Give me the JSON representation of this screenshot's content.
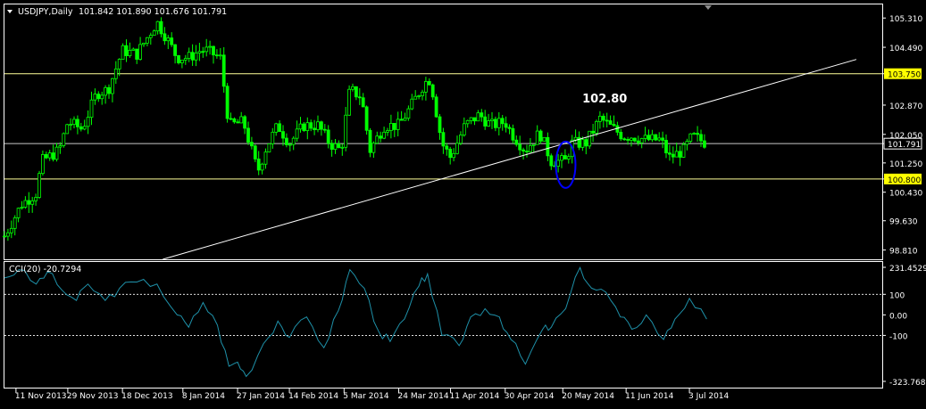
{
  "header": {
    "symbol": "USDJPY,Daily",
    "ohlc": "101.842 101.890 101.676 101.791",
    "menu_icon": "triangle-down-icon",
    "shift_marker_icon": "triangle-down-icon"
  },
  "colors": {
    "background": "#000000",
    "frame": "#ffffff",
    "candle": "#00ff00",
    "cci_line": "#1e90a8",
    "hline": "#ffff99",
    "trendline": "#ffffff",
    "ellipse": "#0000ff",
    "price_label_bg": "#ffff00",
    "current_label_bg": "#000000"
  },
  "chart_data": [
    {
      "type": "candlestick",
      "title": "USDJPY,Daily",
      "ylim": [
        98.55,
        105.69
      ],
      "y_ticks": [
        "105.310",
        "104.490",
        "103.750",
        "102.870",
        "102.050",
        "101.791",
        "101.250",
        "100.800",
        "100.430",
        "99.630",
        "98.810"
      ],
      "x_ticks": [
        "11 Nov 2013",
        "29 Nov 2013",
        "18 Dec 2013",
        "8 Jan 2014",
        "27 Jan 2014",
        "14 Feb 2014",
        "5 Mar 2014",
        "24 Mar 2014",
        "11 Apr 2014",
        "30 Apr 2014",
        "20 May 2014",
        "11 Jun 2014",
        "3 Jul 2014"
      ],
      "series_path": [
        [
          "2013-11-07",
          99.2
        ],
        [
          "2013-11-13",
          100.1
        ],
        [
          "2013-11-18",
          100.4
        ],
        [
          "2013-11-20",
          101.3
        ],
        [
          "2013-11-26",
          101.6
        ],
        [
          "2013-11-29",
          102.4
        ],
        [
          "2013-12-04",
          102.2
        ],
        [
          "2013-12-09",
          103.2
        ],
        [
          "2013-12-13",
          103.3
        ],
        [
          "2013-12-18",
          104.4
        ],
        [
          "2013-12-23",
          104.3
        ],
        [
          "2013-12-30",
          105.2
        ],
        [
          "2014-01-02",
          104.8
        ],
        [
          "2014-01-06",
          104.2
        ],
        [
          "2014-01-10",
          104.2
        ],
        [
          "2014-01-14",
          104.4
        ],
        [
          "2014-01-16",
          104.4
        ],
        [
          "2014-01-21",
          104.2
        ],
        [
          "2014-01-24",
          102.3
        ],
        [
          "2014-01-29",
          102.4
        ],
        [
          "2014-02-03",
          101.0
        ],
        [
          "2014-02-06",
          101.7
        ],
        [
          "2014-02-10",
          102.3
        ],
        [
          "2014-02-14",
          101.8
        ],
        [
          "2014-02-19",
          102.3
        ],
        [
          "2014-02-24",
          102.3
        ],
        [
          "2014-02-28",
          101.8
        ],
        [
          "2014-03-04",
          101.6
        ],
        [
          "2014-03-07",
          103.3
        ],
        [
          "2014-03-11",
          103.1
        ],
        [
          "2014-03-14",
          101.6
        ],
        [
          "2014-03-19",
          102.3
        ],
        [
          "2014-03-24",
          102.3
        ],
        [
          "2014-03-28",
          102.8
        ],
        [
          "2014-04-02",
          103.5
        ],
        [
          "2014-04-04",
          103.6
        ],
        [
          "2014-04-08",
          101.8
        ],
        [
          "2014-04-11",
          101.4
        ],
        [
          "2014-04-16",
          102.3
        ],
        [
          "2014-04-21",
          102.6
        ],
        [
          "2014-04-25",
          102.3
        ],
        [
          "2014-04-30",
          102.4
        ],
        [
          "2014-05-02",
          102.1
        ],
        [
          "2014-05-07",
          101.6
        ],
        [
          "2014-05-12",
          102.1
        ],
        [
          "2014-05-16",
          101.3
        ],
        [
          "2014-05-21",
          101.3
        ],
        [
          "2014-05-23",
          101.8
        ],
        [
          "2014-05-28",
          101.8
        ],
        [
          "2014-06-02",
          102.5
        ],
        [
          "2014-06-05",
          102.3
        ],
        [
          "2014-06-10",
          102.0
        ],
        [
          "2014-06-13",
          102.0
        ],
        [
          "2014-06-18",
          101.9
        ],
        [
          "2014-06-23",
          101.9
        ],
        [
          "2014-06-26",
          101.4
        ],
        [
          "2014-07-01",
          101.6
        ],
        [
          "2014-07-04",
          102.0
        ],
        [
          "2014-07-09",
          101.8
        ]
      ],
      "horizontal_lines": [
        {
          "label": "103.750",
          "value": 103.75,
          "style": "yellow-label"
        },
        {
          "label": "101.791",
          "value": 101.791,
          "style": "current-price"
        },
        {
          "label": "100.800",
          "value": 100.8,
          "style": "yellow-label"
        }
      ],
      "trendline": {
        "start": [
          "2014-01-01",
          98.55
        ],
        "end": [
          "2014-08-30",
          104.15
        ]
      },
      "annotations": [
        {
          "text": "102.80",
          "x": "2014-06-02",
          "y": 102.8
        },
        {
          "type": "ellipse",
          "x": "2014-05-21",
          "y": 101.2
        }
      ],
      "grid": false,
      "legend": "none"
    },
    {
      "type": "line",
      "title": "CCI(20) -20.7294",
      "ylim": [
        -323.768,
        231.4529
      ],
      "y_ticks": [
        "231.4529",
        "100",
        "0.00",
        "-100",
        "-323.768"
      ],
      "levels": [
        100,
        -100
      ],
      "series": [
        {
          "values": [
            [
              "2013-11-07",
              180
            ],
            [
              "2013-11-12",
              220
            ],
            [
              "2013-11-18",
              150
            ],
            [
              "2013-11-22",
              210
            ],
            [
              "2013-11-27",
              120
            ],
            [
              "2013-12-02",
              70
            ],
            [
              "2013-12-06",
              150
            ],
            [
              "2013-12-12",
              70
            ],
            [
              "2013-12-17",
              130
            ],
            [
              "2013-12-23",
              160
            ],
            [
              "2013-12-30",
              150
            ],
            [
              "2014-01-06",
              0
            ],
            [
              "2014-01-10",
              -60
            ],
            [
              "2014-01-15",
              60
            ],
            [
              "2014-01-20",
              -50
            ],
            [
              "2014-01-24",
              -250
            ],
            [
              "2014-01-27",
              -230
            ],
            [
              "2014-01-30",
              -300
            ],
            [
              "2014-02-05",
              -140
            ],
            [
              "2014-02-10",
              -30
            ],
            [
              "2014-02-14",
              -110
            ],
            [
              "2014-02-20",
              -10
            ],
            [
              "2014-02-26",
              -160
            ],
            [
              "2014-03-03",
              20
            ],
            [
              "2014-03-07",
              220
            ],
            [
              "2014-03-12",
              130
            ],
            [
              "2014-03-17",
              -80
            ],
            [
              "2014-03-21",
              -130
            ],
            [
              "2014-03-26",
              -20
            ],
            [
              "2014-03-31",
              140
            ],
            [
              "2014-04-03",
              200
            ],
            [
              "2014-04-08",
              -100
            ],
            [
              "2014-04-14",
              -150
            ],
            [
              "2014-04-18",
              -10
            ],
            [
              "2014-04-23",
              30
            ],
            [
              "2014-04-28",
              -10
            ],
            [
              "2014-05-02",
              -120
            ],
            [
              "2014-05-07",
              -240
            ],
            [
              "2014-05-13",
              -70
            ],
            [
              "2014-05-16",
              -60
            ],
            [
              "2014-05-21",
              30
            ],
            [
              "2014-05-26",
              230
            ],
            [
              "2014-05-30",
              130
            ],
            [
              "2014-06-04",
              110
            ],
            [
              "2014-06-09",
              -10
            ],
            [
              "2014-06-13",
              -70
            ],
            [
              "2014-06-18",
              0
            ],
            [
              "2014-06-24",
              -120
            ],
            [
              "2014-06-28",
              -20
            ],
            [
              "2014-07-03",
              80
            ],
            [
              "2014-07-09",
              -20.7294
            ]
          ]
        }
      ],
      "grid": false,
      "legend": "none"
    }
  ]
}
